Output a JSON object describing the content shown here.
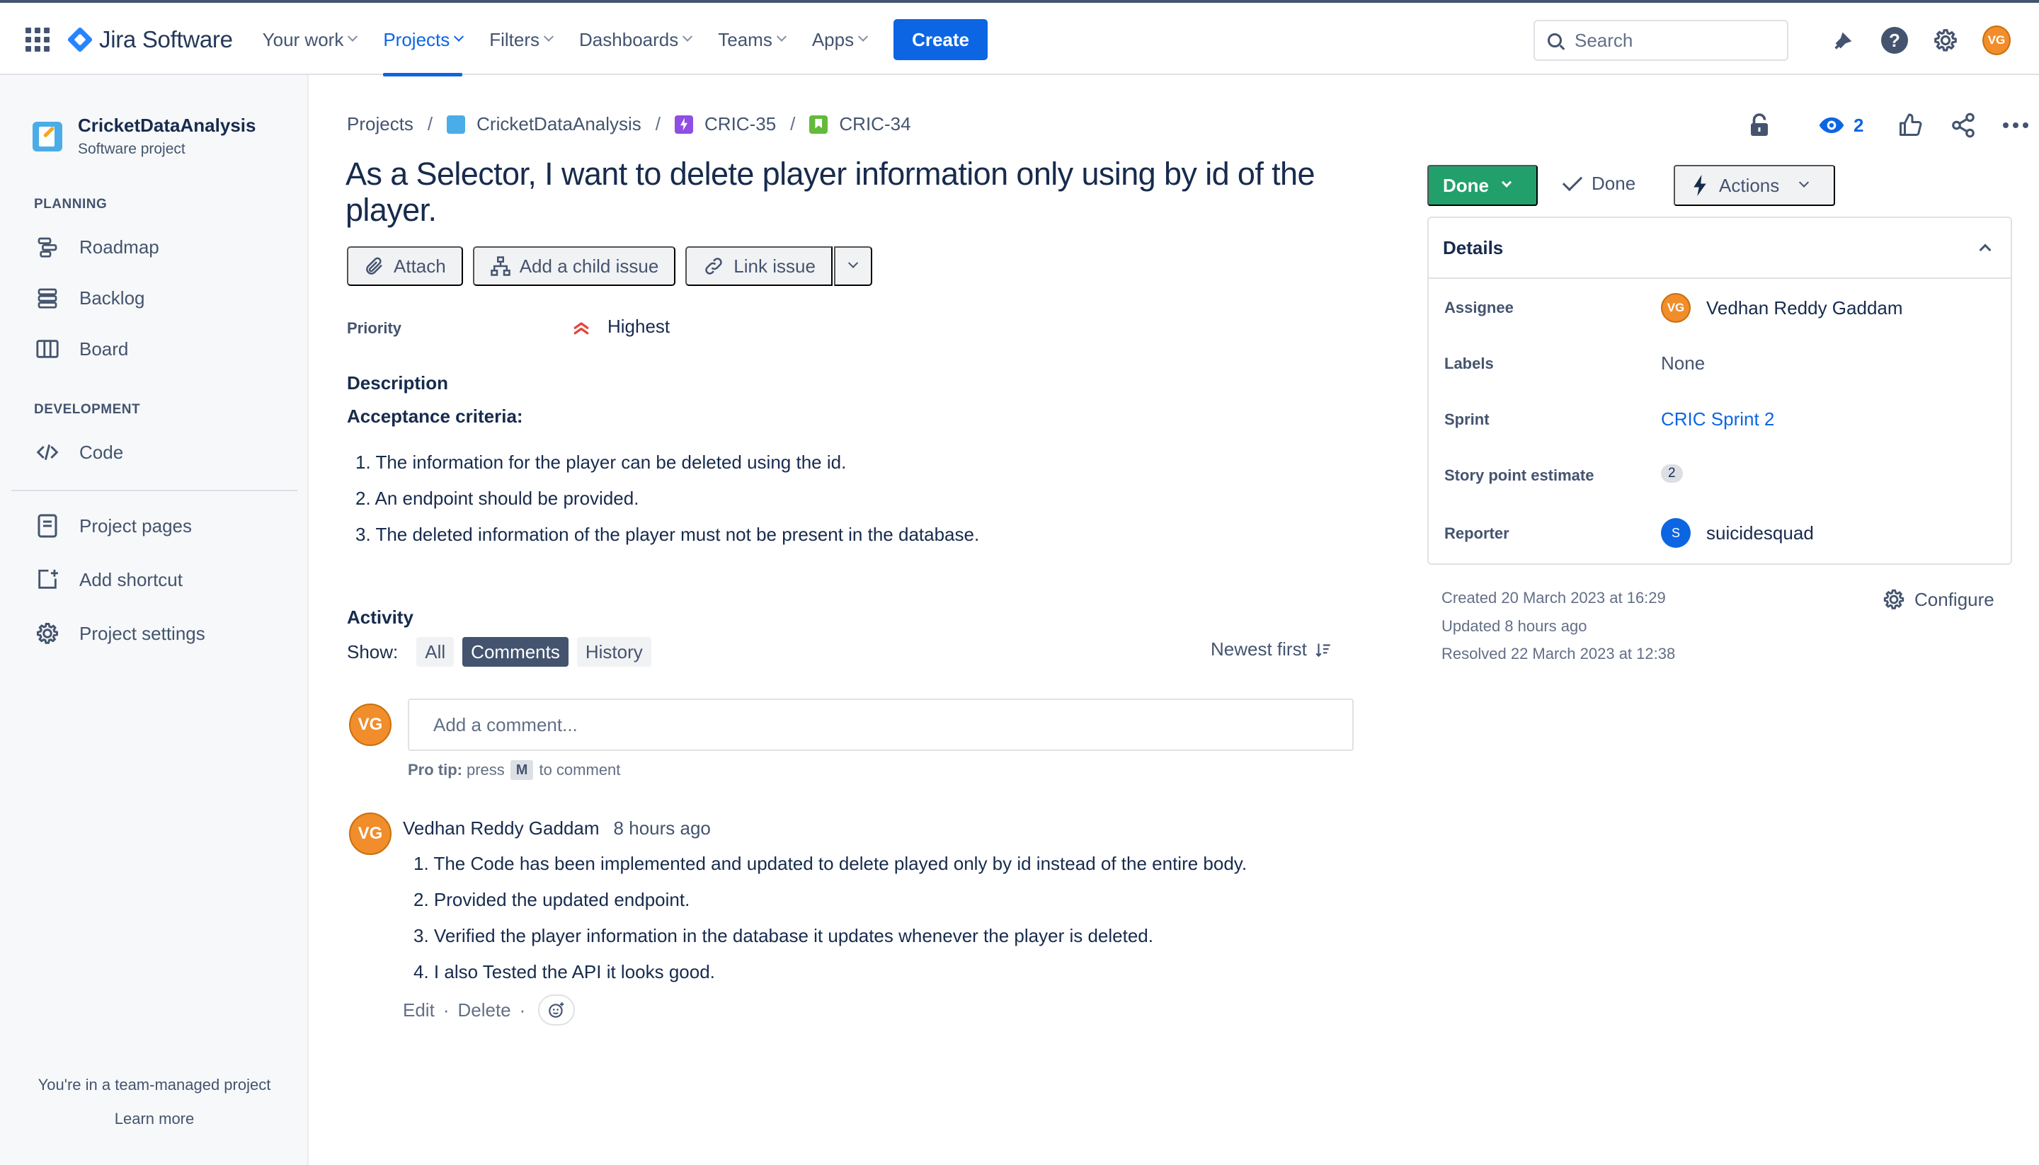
{
  "app": {
    "name": "Jira Software"
  },
  "nav": {
    "your_work": "Your work",
    "projects": "Projects",
    "filters": "Filters",
    "dashboards": "Dashboards",
    "teams": "Teams",
    "apps": "Apps",
    "create": "Create",
    "search_placeholder": "Search",
    "user_initials": "VG"
  },
  "sidebar": {
    "project_name": "CricketDataAnalysis",
    "project_type": "Software project",
    "planning_label": "PLANNING",
    "roadmap": "Roadmap",
    "backlog": "Backlog",
    "board": "Board",
    "development_label": "DEVELOPMENT",
    "code": "Code",
    "project_pages": "Project pages",
    "add_shortcut": "Add shortcut",
    "project_settings": "Project settings",
    "footer_text": "You're in a team-managed project",
    "learn_more": "Learn more"
  },
  "breadcrumb": {
    "projects": "Projects",
    "project": "CricketDataAnalysis",
    "epic": "CRIC-35",
    "issue": "CRIC-34",
    "sep": "/"
  },
  "issue": {
    "title": "As a Selector, I want to delete player information only using by id of the player.",
    "attach": "Attach",
    "add_child": "Add a child issue",
    "link_issue": "Link issue",
    "priority_label": "Priority",
    "priority_value": "Highest",
    "description_label": "Description",
    "acceptance_head": "Acceptance criteria:",
    "acceptance": [
      "1. The information for the player can be deleted using the id.",
      "2. An endpoint should be provided.",
      "3. The deleted information of the player must not be present in the database."
    ]
  },
  "activity": {
    "label": "Activity",
    "show": "Show:",
    "all": "All",
    "comments": "Comments",
    "history": "History",
    "sort": "Newest first",
    "add_comment_placeholder": "Add a comment...",
    "pro_tip_bold": "Pro tip:",
    "pro_tip_press": "press",
    "pro_tip_key": "M",
    "pro_tip_rest": "to comment",
    "comment": {
      "author": "Vedhan Reddy Gaddam",
      "time": "8 hours ago",
      "initials": "VG",
      "lines": [
        "1. The Code has been implemented and updated to delete played only by id instead of the entire body.",
        "2. Provided the updated endpoint.",
        "3. Verified the player information in the database it updates whenever the player is deleted.",
        "4. I also Tested the API it looks good."
      ],
      "edit": "Edit",
      "delete": "Delete",
      "dot": "·"
    }
  },
  "panel": {
    "watch_count": "2",
    "status": "Done",
    "resolution": "Done",
    "actions": "Actions",
    "details_title": "Details",
    "assignee_label": "Assignee",
    "assignee": "Vedhan Reddy Gaddam",
    "assignee_initials": "VG",
    "labels_label": "Labels",
    "labels": "None",
    "sprint_label": "Sprint",
    "sprint": "CRIC Sprint 2",
    "story_points_label": "Story point estimate",
    "story_points": "2",
    "reporter_label": "Reporter",
    "reporter": "suicidesquad",
    "reporter_initial": "S",
    "created": "Created 20 March 2023 at 16:29",
    "updated": "Updated 8 hours ago",
    "resolved": "Resolved 22 March 2023 at 12:38",
    "configure": "Configure"
  },
  "colors": {
    "brand_blue": "#0c66e4",
    "status_done": "#22a06b",
    "avatar_orange": "#f18d2a",
    "priority_highest": "#e2483d"
  }
}
